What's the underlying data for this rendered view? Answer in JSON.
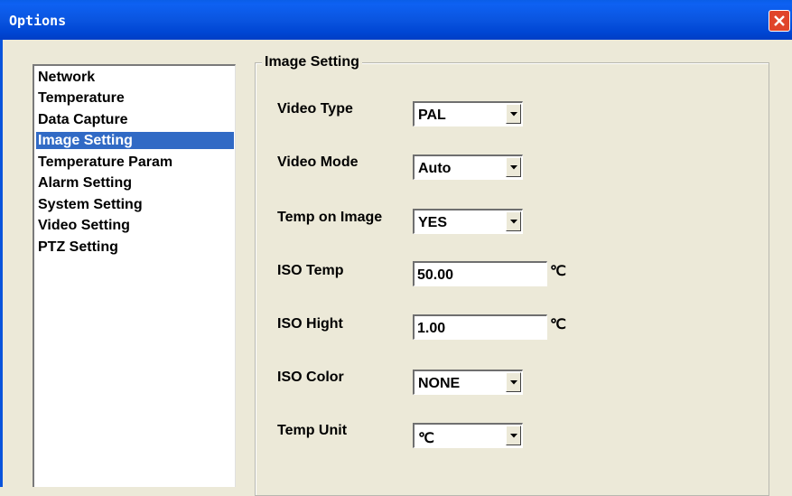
{
  "window": {
    "title": "Options"
  },
  "sidebar": {
    "items": [
      {
        "label": "Network",
        "selected": false
      },
      {
        "label": "Temperature",
        "selected": false
      },
      {
        "label": "Data Capture",
        "selected": false
      },
      {
        "label": "Image Setting",
        "selected": true
      },
      {
        "label": "Temperature Param",
        "selected": false
      },
      {
        "label": "Alarm Setting",
        "selected": false
      },
      {
        "label": "System Setting",
        "selected": false
      },
      {
        "label": "Video Setting",
        "selected": false
      },
      {
        "label": "PTZ Setting",
        "selected": false
      }
    ]
  },
  "group": {
    "title": "Image Setting",
    "video_type": {
      "label": "Video Type",
      "value": "PAL"
    },
    "video_mode": {
      "label": "Video Mode",
      "value": "Auto"
    },
    "temp_on_image": {
      "label": "Temp on Image",
      "value": "YES"
    },
    "iso_temp": {
      "label": "ISO Temp",
      "value": "50.00",
      "unit": "℃"
    },
    "iso_hight": {
      "label": "ISO Hight",
      "value": "1.00",
      "unit": "℃"
    },
    "iso_color": {
      "label": "ISO Color",
      "value": "NONE"
    },
    "temp_unit": {
      "label": "Temp Unit",
      "value": "℃"
    }
  },
  "colors": {
    "title_bar": "#0a55e0",
    "selection": "#316ac5",
    "dialog_bg": "#ece9d8",
    "close_button": "#e0442a"
  }
}
